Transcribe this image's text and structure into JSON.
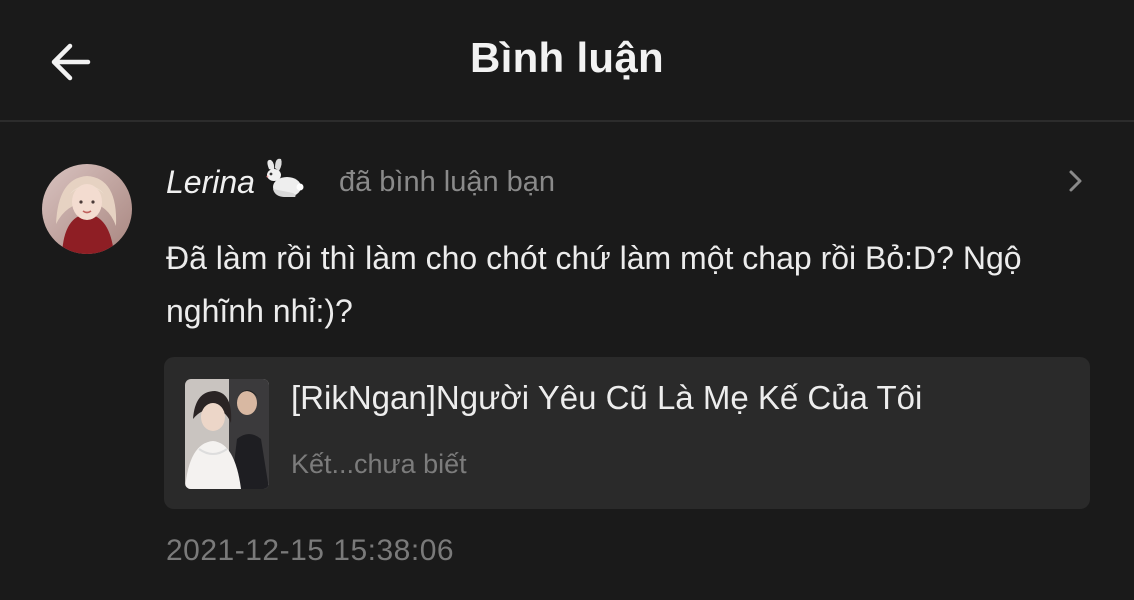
{
  "header": {
    "title": "Bình luận",
    "back_icon": "arrow-left-icon"
  },
  "notification": {
    "username": "Lerina",
    "username_emoji": "rabbit-icon",
    "action": "đã bình luận bạn",
    "comment": "Đã làm rồi thì làm cho chót chứ làm một chap rồi Bỏ:D? Ngộ nghĩnh nhỉ:)?",
    "story": {
      "title": "[RikNgan]Người Yêu Cũ Là Mẹ Kế Của Tôi",
      "subtitle": "Kết...chưa biết"
    },
    "timestamp": "2021-12-15 15:38:06"
  },
  "colors": {
    "background": "#1a1a1a",
    "card": "#2a2a2a",
    "text_primary": "#ececec",
    "text_muted": "#7c7c7c"
  }
}
